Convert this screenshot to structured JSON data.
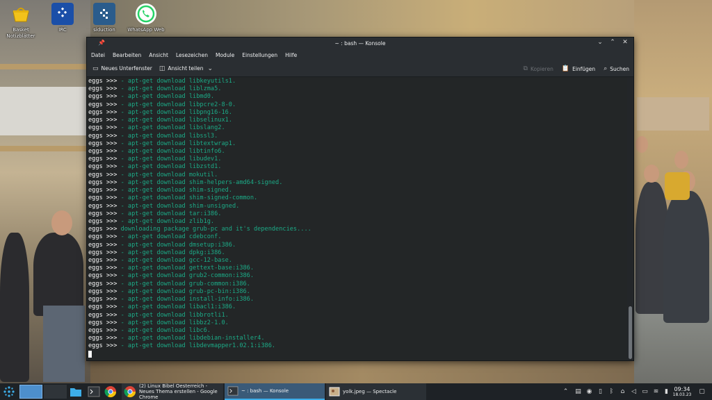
{
  "desktop": {
    "icons": [
      {
        "label": "Basket\nNotizblätter"
      },
      {
        "label": "IRC"
      },
      {
        "label": "siduction"
      },
      {
        "label": "WhatsApp Web"
      }
    ]
  },
  "window": {
    "title": "~ : bash — Konsole",
    "menu": [
      "Datei",
      "Bearbeiten",
      "Ansicht",
      "Lesezeichen",
      "Module",
      "Einstellungen",
      "Hilfe"
    ],
    "toolbar": {
      "new_tab": "Neues Unterfenster",
      "split_view": "Ansicht teilen",
      "copy": "Kopieren",
      "paste": "Einfügen",
      "find": "Suchen"
    }
  },
  "terminal": {
    "prompt": "eggs >>> ",
    "lines": [
      {
        "type": "cmd",
        "text": "- apt-get download libkeyutils1."
      },
      {
        "type": "cmd",
        "text": "- apt-get download liblzma5."
      },
      {
        "type": "cmd",
        "text": "- apt-get download libmd0."
      },
      {
        "type": "cmd",
        "text": "- apt-get download libpcre2-8-0."
      },
      {
        "type": "cmd",
        "text": "- apt-get download libpng16-16."
      },
      {
        "type": "cmd",
        "text": "- apt-get download libselinux1."
      },
      {
        "type": "cmd",
        "text": "- apt-get download libslang2."
      },
      {
        "type": "cmd",
        "text": "- apt-get download libssl3."
      },
      {
        "type": "cmd",
        "text": "- apt-get download libtextwrap1."
      },
      {
        "type": "cmd",
        "text": "- apt-get download libtinfo6."
      },
      {
        "type": "cmd",
        "text": "- apt-get download libudev1."
      },
      {
        "type": "cmd",
        "text": "- apt-get download libzstd1."
      },
      {
        "type": "cmd",
        "text": "- apt-get download mokutil."
      },
      {
        "type": "cmd",
        "text": "- apt-get download shim-helpers-amd64-signed."
      },
      {
        "type": "cmd",
        "text": "- apt-get download shim-signed."
      },
      {
        "type": "cmd",
        "text": "- apt-get download shim-signed-common."
      },
      {
        "type": "cmd",
        "text": "- apt-get download shim-unsigned."
      },
      {
        "type": "cmd",
        "text": "- apt-get download tar:i386."
      },
      {
        "type": "cmd",
        "text": "- apt-get download zlib1g."
      },
      {
        "type": "msg",
        "text": "downloading package grub-pc and it's dependencies...."
      },
      {
        "type": "cmd",
        "text": "- apt-get download cdebconf."
      },
      {
        "type": "cmd",
        "text": "- apt-get download dmsetup:i386."
      },
      {
        "type": "cmd",
        "text": "- apt-get download dpkg:i386."
      },
      {
        "type": "cmd",
        "text": "- apt-get download gcc-12-base."
      },
      {
        "type": "cmd",
        "text": "- apt-get download gettext-base:i386."
      },
      {
        "type": "cmd",
        "text": "- apt-get download grub2-common:i386."
      },
      {
        "type": "cmd",
        "text": "- apt-get download grub-common:i386."
      },
      {
        "type": "cmd",
        "text": "- apt-get download grub-pc-bin:i386."
      },
      {
        "type": "cmd",
        "text": "- apt-get download install-info:i386."
      },
      {
        "type": "cmd",
        "text": "- apt-get download libacl1:i386."
      },
      {
        "type": "cmd",
        "text": "- apt-get download libbrotli1."
      },
      {
        "type": "cmd",
        "text": "- apt-get download libbz2-1.0."
      },
      {
        "type": "cmd",
        "text": "- apt-get download libc6."
      },
      {
        "type": "cmd",
        "text": "- apt-get download libdebian-installer4."
      },
      {
        "type": "cmd",
        "text": "- apt-get download libdevmapper1.02.1:i386."
      }
    ]
  },
  "taskbar": {
    "tasks": [
      {
        "label": "(2) Linux Bibel Oesterreich - Neues Thema erstellen - Google Chrome"
      },
      {
        "label": "~ : bash — Konsole"
      },
      {
        "label": "yolk.jpeg — Spectacle"
      }
    ],
    "clock": {
      "time": "09:34",
      "date": "18.03.23"
    }
  },
  "colors": {
    "terminal_bg": "#232627",
    "terminal_green": "#1cab87",
    "panel_bg": "#1e2226",
    "window_chrome": "#2a2e32",
    "active_task": "#3a5a78"
  }
}
